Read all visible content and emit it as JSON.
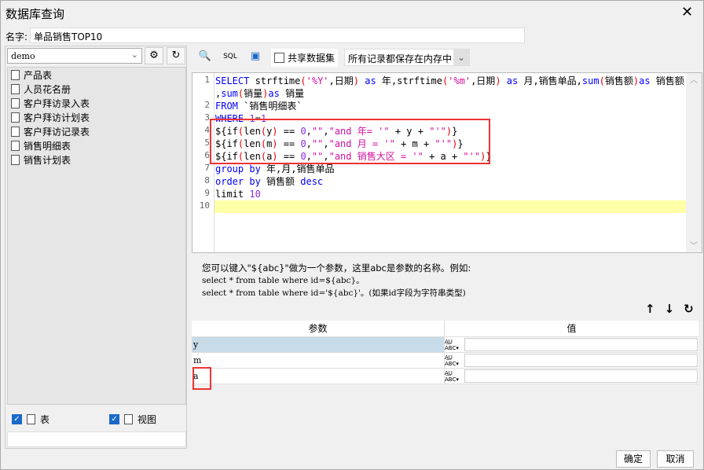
{
  "window": {
    "title": "数据库查询",
    "close_icon": "close-icon"
  },
  "name": {
    "label": "名字:",
    "value": "单品销售TOP10"
  },
  "left": {
    "db": "demo",
    "tables": [
      "产品表",
      "人员花名册",
      "客户拜访录入表",
      "客户拜访计划表",
      "客户拜访记录表",
      "销售明细表",
      "销售计划表"
    ],
    "check_table": "表",
    "check_view": "视图"
  },
  "toolbar": {
    "shared_label": "共享数据集",
    "memory_option": "所有记录都保存在内存中"
  },
  "editor": {
    "lines": [
      {
        "n": "1",
        "t": [
          [
            "SELECT",
            "kw"
          ],
          " strftime",
          [
            "(",
            "pr"
          ],
          [
            "'%Y'",
            "st"
          ],
          ",日期",
          [
            ")",
            "pr"
          ],
          " ",
          [
            "as",
            "kw"
          ],
          " 年,strftime",
          [
            "(",
            "pr"
          ],
          [
            "'%m'",
            "st"
          ],
          ",日期",
          [
            ")",
            "pr"
          ],
          " ",
          [
            "as",
            "kw"
          ],
          " 月,销售单品,",
          [
            "sum",
            "kw"
          ],
          [
            "(",
            "pr"
          ],
          "销售额",
          [
            ")",
            "pr"
          ],
          [
            "as",
            "kw"
          ],
          " 销售额"
        ]
      },
      {
        "n": "",
        "t": [
          ",",
          [
            "sum",
            "kw"
          ],
          [
            "(",
            "pr"
          ],
          "销量",
          [
            ")",
            "pr"
          ],
          [
            "as",
            "kw"
          ],
          " 销量"
        ]
      },
      {
        "n": "2",
        "t": [
          [
            "FROM",
            "kw"
          ],
          " `销售明细表`"
        ]
      },
      {
        "n": "3",
        "t": [
          [
            "WHERE",
            "kw"
          ],
          " ",
          [
            "1",
            "nm"
          ],
          "=",
          [
            "1",
            "nm"
          ]
        ]
      },
      {
        "n": "4",
        "t": [
          "${if",
          [
            "(",
            "pr"
          ],
          "len",
          [
            "(",
            "pr"
          ],
          "y",
          [
            ")",
            "pr"
          ],
          " == ",
          [
            "0",
            "nm"
          ],
          ",",
          [
            "\"\"",
            "st"
          ],
          ",",
          [
            "\"and 年= '\"",
            "st"
          ],
          " + y + ",
          [
            "\"'\"",
            "st"
          ],
          [
            ")",
            "pr"
          ],
          "}"
        ]
      },
      {
        "n": "5",
        "t": [
          "${if",
          [
            "(",
            "pr"
          ],
          "len",
          [
            "(",
            "pr"
          ],
          "m",
          [
            ")",
            "pr"
          ],
          " == ",
          [
            "0",
            "nm"
          ],
          ",",
          [
            "\"\"",
            "st"
          ],
          ",",
          [
            "\"and 月 = '\"",
            "st"
          ],
          " + m + ",
          [
            "\"'\"",
            "st"
          ],
          [
            ")",
            "pr"
          ],
          "}"
        ]
      },
      {
        "n": "6",
        "t": [
          "${if",
          [
            "(",
            "pr"
          ],
          "len",
          [
            "(",
            "pr"
          ],
          "a",
          [
            ")",
            "pr"
          ],
          " == ",
          [
            "0",
            "nm"
          ],
          ",",
          [
            "\"\"",
            "st"
          ],
          ",",
          [
            "\"and 销售大区 = '\"",
            "st"
          ],
          " + a + ",
          [
            "\"'\"",
            "st"
          ],
          [
            ")",
            "pr"
          ],
          "}"
        ]
      },
      {
        "n": "7",
        "t": [
          [
            "group by",
            "kw"
          ],
          " 年,月,销售单品"
        ]
      },
      {
        "n": "8",
        "t": [
          [
            "order by",
            "kw"
          ],
          " 销售额 ",
          [
            "desc",
            "kw"
          ]
        ]
      },
      {
        "n": "9",
        "t": [
          "limit ",
          [
            "10",
            "nm"
          ]
        ]
      },
      {
        "n": "10",
        "t": []
      }
    ]
  },
  "hint": {
    "line1": "您可以键入\"${abc}\"做为一个参数，这里abc是参数的名称。例如:",
    "line2": "select * from table where id=${abc}。",
    "line3": "select * from table where id='${abc}'。(如果id字段为字符串类型)"
  },
  "params": {
    "col_param": "参数",
    "col_value": "值",
    "rows": [
      {
        "name": "y",
        "value": ""
      },
      {
        "name": "m",
        "value": ""
      },
      {
        "name": "a",
        "value": ""
      }
    ]
  },
  "footer": {
    "ok": "确定",
    "cancel": "取消"
  }
}
